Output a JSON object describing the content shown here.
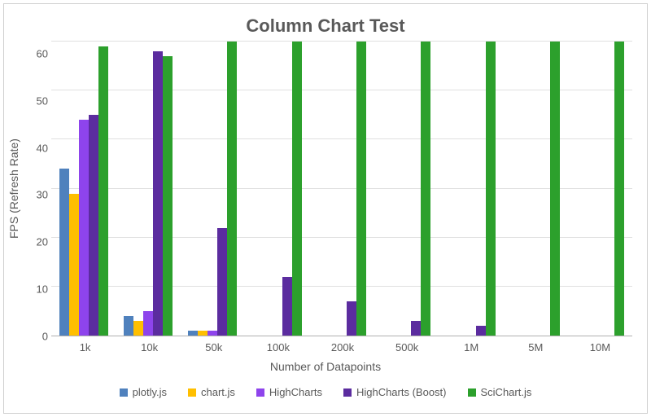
{
  "chart_data": {
    "type": "bar",
    "title": "Column Chart Test",
    "xlabel": "Number of Datapoints",
    "ylabel": "FPS (Refresh Rate)",
    "categories": [
      "1k",
      "10k",
      "50k",
      "100k",
      "200k",
      "500k",
      "1M",
      "5M",
      "10M"
    ],
    "y_ticks": [
      0,
      10,
      20,
      30,
      40,
      50,
      60
    ],
    "ylim": [
      0,
      60
    ],
    "series": [
      {
        "name": "plotly.js",
        "color": "#4f81bd",
        "values": [
          34,
          4,
          1,
          0,
          0,
          0,
          0,
          0,
          0
        ]
      },
      {
        "name": "chart.js",
        "color": "#ffbf00",
        "values": [
          29,
          3,
          1,
          0,
          0,
          0,
          0,
          0,
          0
        ]
      },
      {
        "name": "HighCharts",
        "color": "#8e44ec",
        "values": [
          44,
          5,
          1,
          0,
          0,
          0,
          0,
          0,
          0
        ]
      },
      {
        "name": "HighCharts (Boost)",
        "color": "#5b2c9f",
        "values": [
          45,
          58,
          22,
          12,
          7,
          3,
          2,
          0,
          0
        ]
      },
      {
        "name": "SciChart.js",
        "color": "#2ca02c",
        "values": [
          59,
          57,
          60,
          60,
          60,
          60,
          60,
          60,
          60
        ]
      }
    ]
  }
}
